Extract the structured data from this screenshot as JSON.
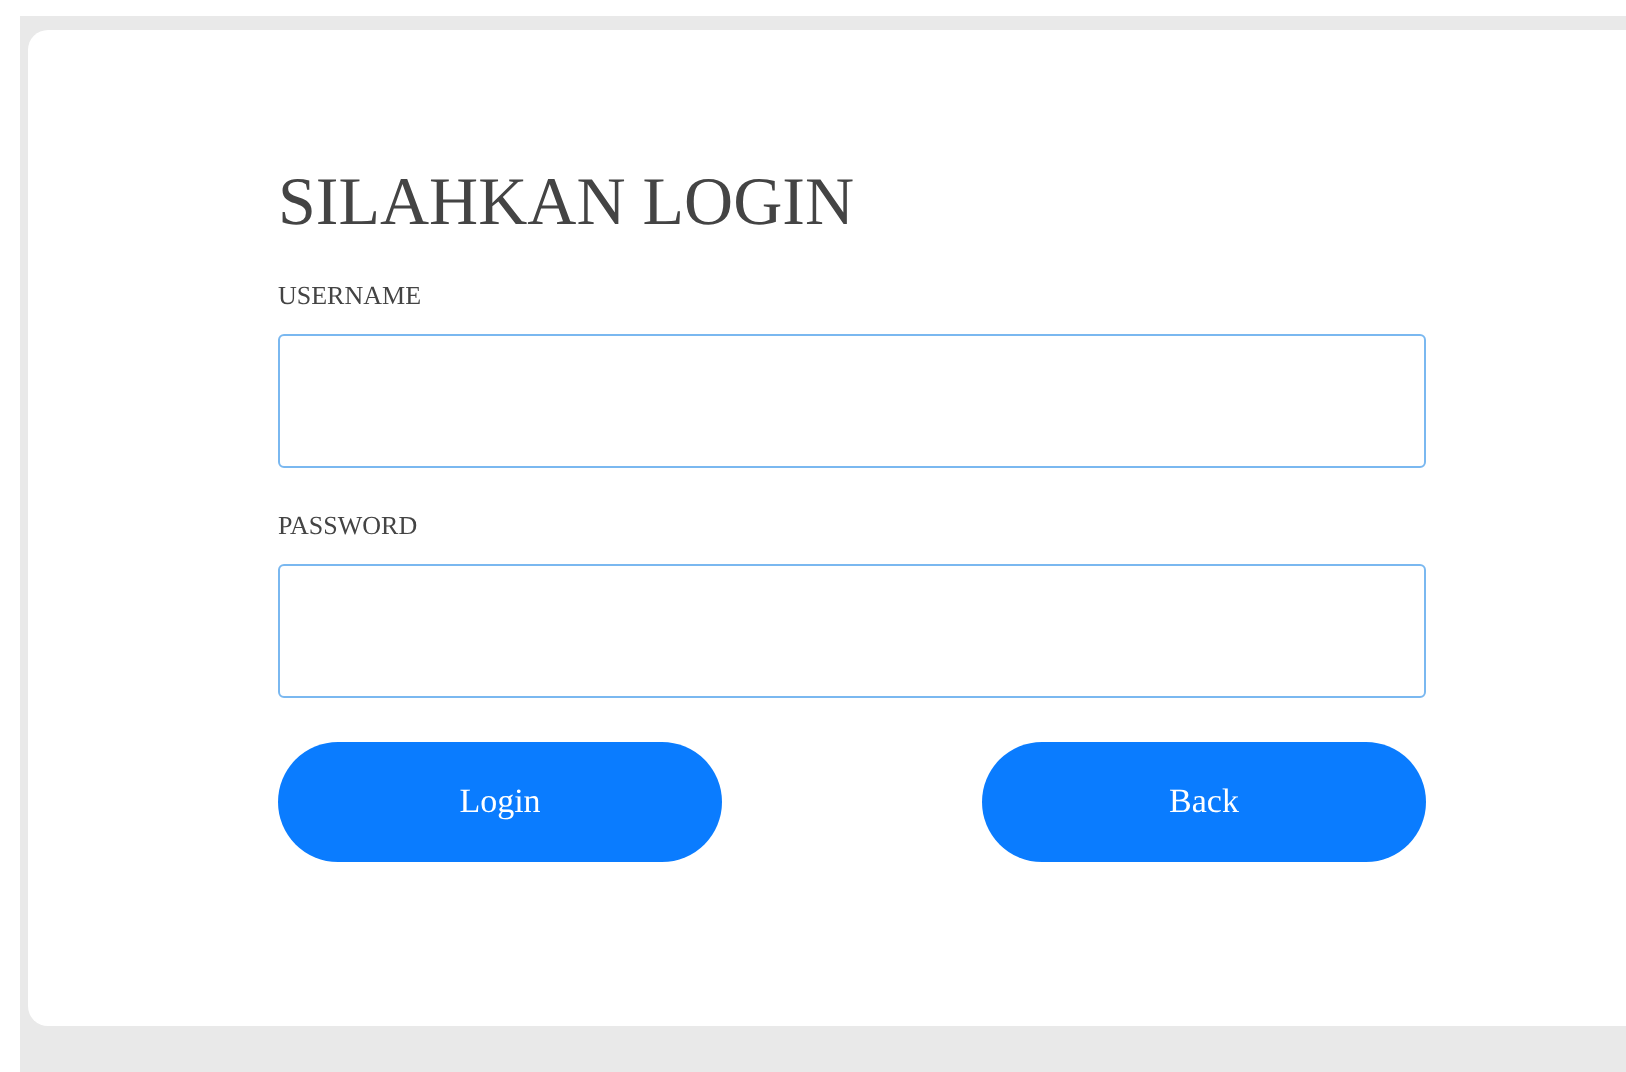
{
  "title": "SILAHKAN LOGIN",
  "fields": [
    {
      "label": "USERNAME"
    },
    {
      "label": "PASSWORD"
    }
  ],
  "buttons": [
    "Login",
    "Back"
  ]
}
